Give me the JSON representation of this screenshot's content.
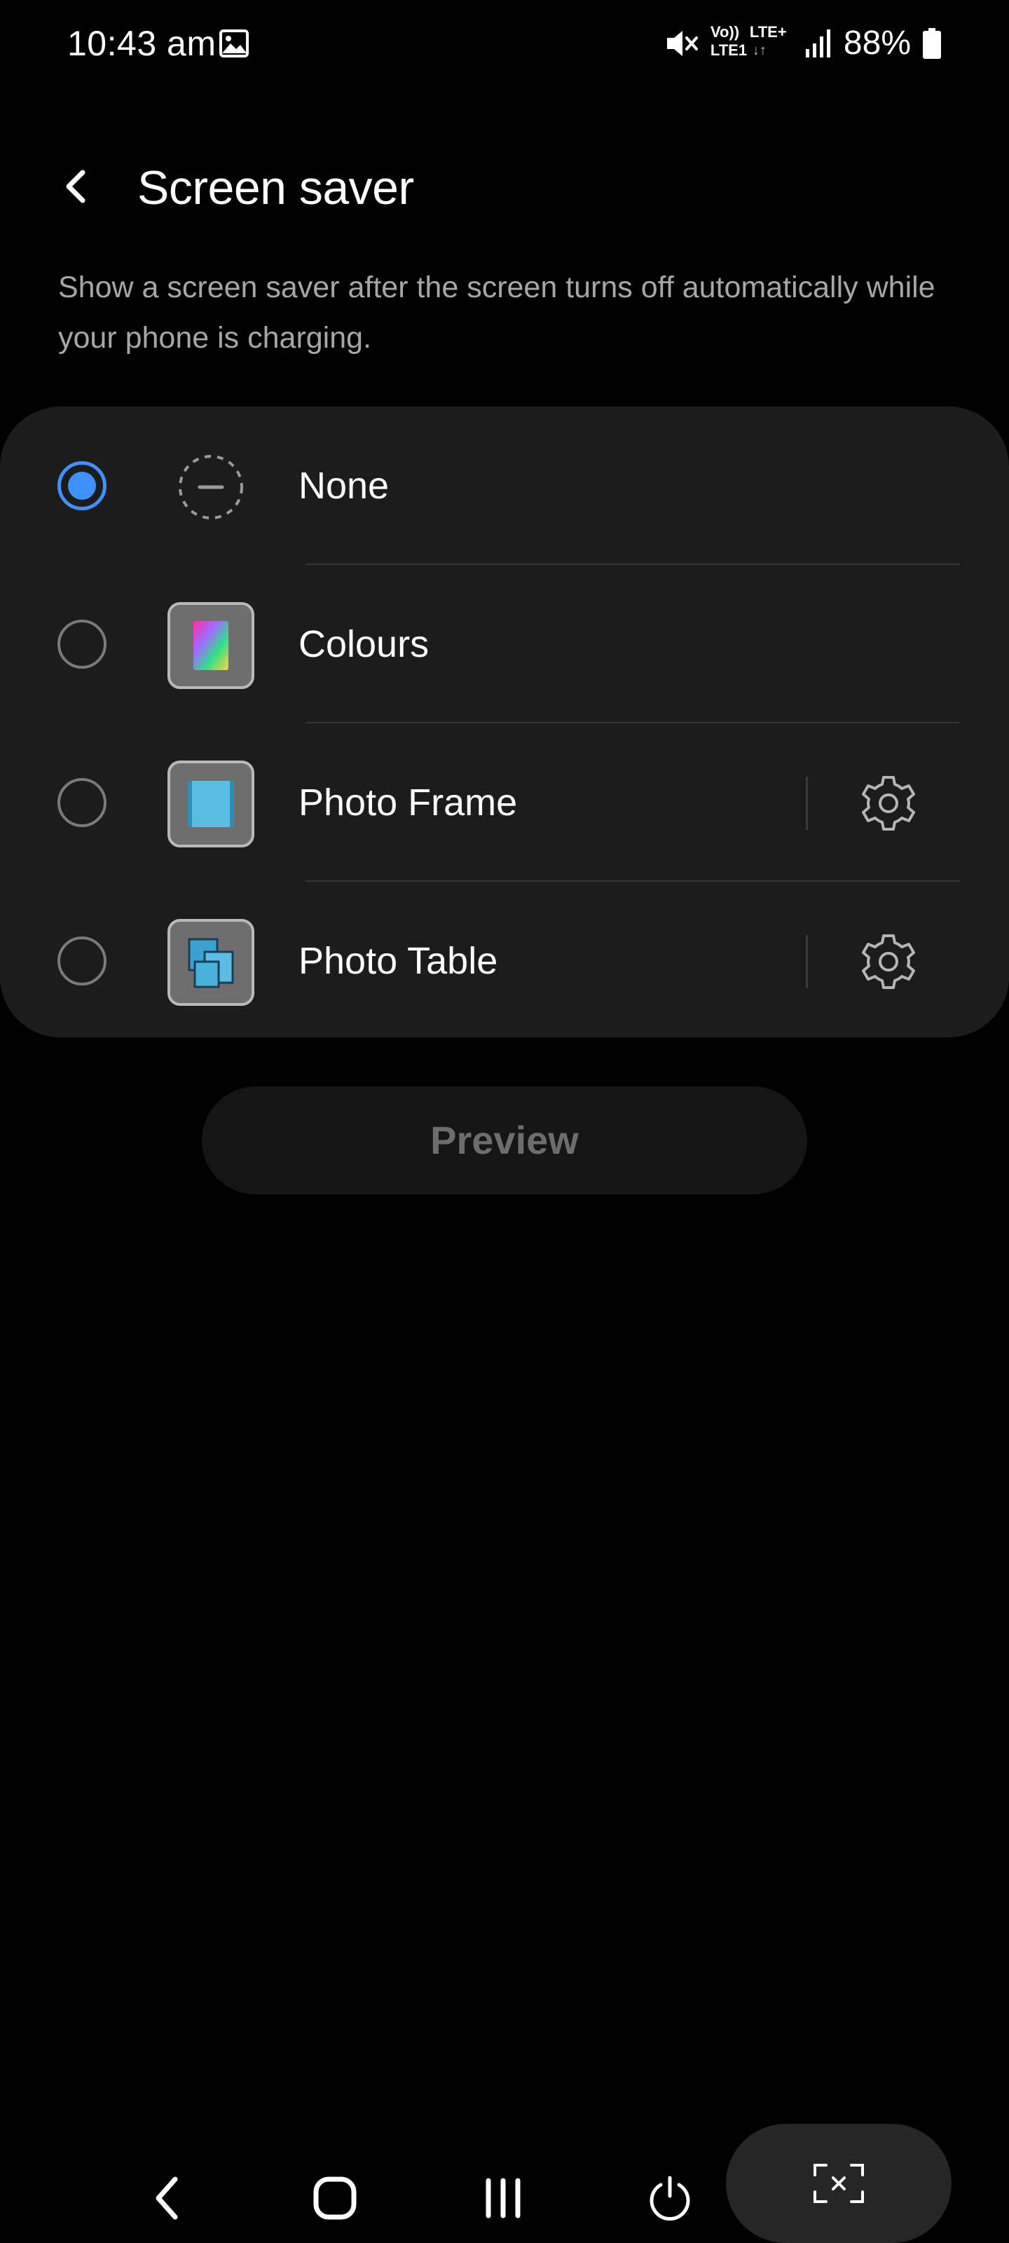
{
  "status_bar": {
    "time": "10:43 am",
    "volte_line1": "Vo))",
    "volte_line2": "LTE1",
    "network_line1": "LTE+",
    "network_arrows": "↓↑",
    "battery_percent": "88%",
    "icons": [
      "gallery-icon",
      "mute-icon",
      "volte-icon",
      "signal-icon",
      "battery-icon"
    ]
  },
  "header": {
    "title": "Screen saver",
    "back_icon": "chevron-left-icon"
  },
  "description": "Show a screen saver after the screen turns off automatically while your phone is charging.",
  "options": [
    {
      "label": "None",
      "selected": true,
      "icon": "none-icon",
      "has_settings": false
    },
    {
      "label": "Colours",
      "selected": false,
      "icon": "colours-icon",
      "has_settings": false
    },
    {
      "label": "Photo Frame",
      "selected": false,
      "icon": "photo-frame-icon",
      "has_settings": true
    },
    {
      "label": "Photo Table",
      "selected": false,
      "icon": "photo-table-icon",
      "has_settings": true
    }
  ],
  "preview_button": {
    "label": "Preview",
    "enabled": false
  },
  "nav_bar": {
    "buttons": [
      "back-icon",
      "home-icon",
      "recents-icon",
      "power-icon",
      "capture-icon"
    ]
  },
  "colors": {
    "background": "#000000",
    "card": "#1c1c1c",
    "accent": "#3e91ff",
    "secondary_text": "#a6a6a6",
    "disabled_text": "#6d6d6d"
  }
}
